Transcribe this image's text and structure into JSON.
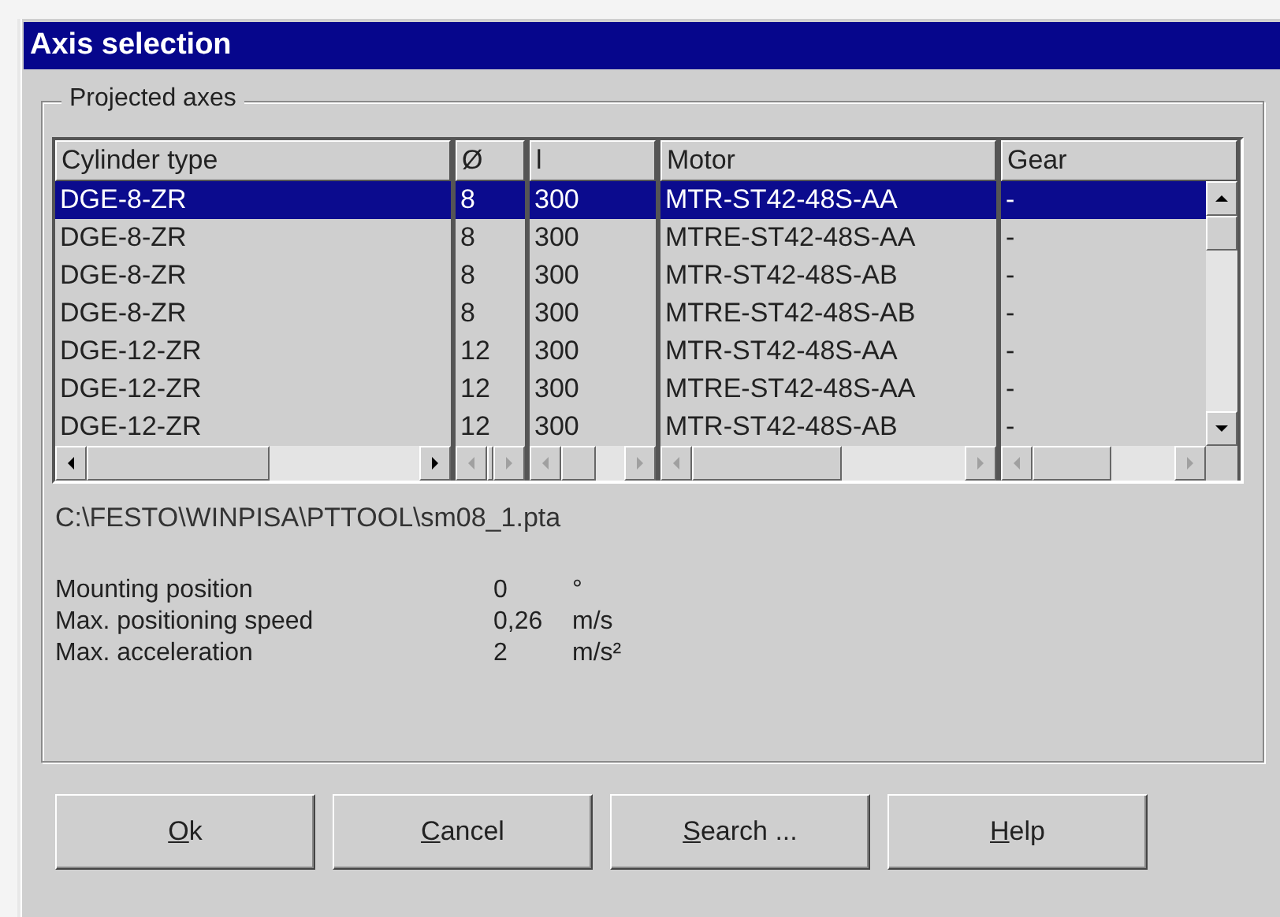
{
  "window": {
    "title": "Axis selection"
  },
  "group": {
    "title": "Projected axes"
  },
  "table": {
    "columns": [
      "Cylinder type",
      "Ø",
      "l",
      "Motor",
      "Gear"
    ],
    "rows": [
      {
        "cells": [
          "DGE-8-ZR",
          "8",
          "300",
          "MTR-ST42-48S-AA",
          "-"
        ],
        "selected": true
      },
      {
        "cells": [
          "DGE-8-ZR",
          "8",
          "300",
          "MTRE-ST42-48S-AA",
          "-"
        ],
        "selected": false
      },
      {
        "cells": [
          "DGE-8-ZR",
          "8",
          "300",
          "MTR-ST42-48S-AB",
          "-"
        ],
        "selected": false
      },
      {
        "cells": [
          "DGE-8-ZR",
          "8",
          "300",
          "MTRE-ST42-48S-AB",
          "-"
        ],
        "selected": false
      },
      {
        "cells": [
          "DGE-12-ZR",
          "12",
          "300",
          "MTR-ST42-48S-AA",
          "-"
        ],
        "selected": false
      },
      {
        "cells": [
          "DGE-12-ZR",
          "12",
          "300",
          "MTRE-ST42-48S-AA",
          "-"
        ],
        "selected": false
      },
      {
        "cells": [
          "DGE-12-ZR",
          "12",
          "300",
          "MTR-ST42-48S-AB",
          "-"
        ],
        "selected": false
      }
    ]
  },
  "file_path": "C:\\FESTO\\WINPISA\\PTTOOL\\sm08_1.pta",
  "properties": [
    {
      "label": "Mounting position",
      "value": "0",
      "unit": "°"
    },
    {
      "label": "Max. positioning speed",
      "value": "0,26",
      "unit": "m/s"
    },
    {
      "label": "Max. acceleration",
      "value": "2",
      "unit": "m/s²"
    }
  ],
  "buttons": [
    "Ok",
    "Cancel",
    "Search ...",
    "Help"
  ]
}
